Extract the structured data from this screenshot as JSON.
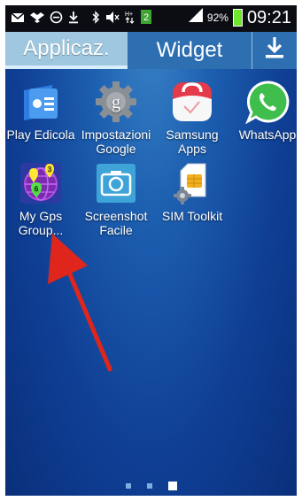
{
  "status": {
    "battery": "92%",
    "time": "09:21",
    "icons": [
      "email-icon",
      "dropbox-icon",
      "do-not-disturb-icon",
      "download-icon",
      "bluetooth-icon",
      "mute-icon",
      "network-icon",
      "sim-2-icon",
      "signal-icon"
    ]
  },
  "tabs": {
    "apps": "Applicaz.",
    "widgets": "Widget"
  },
  "apps": [
    {
      "label": "Play Edicola"
    },
    {
      "label": "Impostazioni Google"
    },
    {
      "label": "Samsung Apps"
    },
    {
      "label": "WhatsApp"
    },
    {
      "label": "My Gps Group..."
    },
    {
      "label": "Screenshot Facile"
    },
    {
      "label": "SIM Toolkit"
    }
  ],
  "pager": {
    "pages": 3,
    "current": 3
  },
  "colors": {
    "arrow": "#e0261c",
    "active_tab": "#9fc8e0",
    "whatsapp": "#3fbd4d"
  }
}
